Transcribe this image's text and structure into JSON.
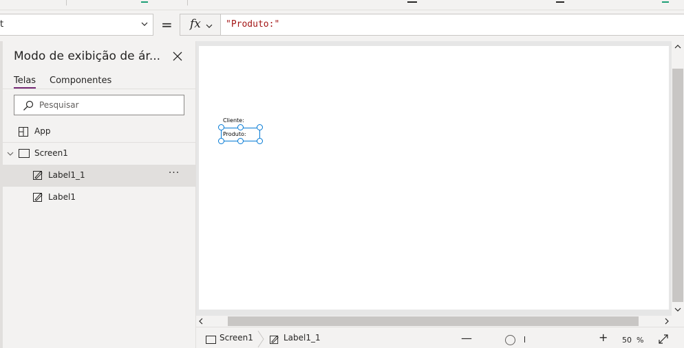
{
  "formula_bar": {
    "property_value": "t",
    "equals": "=",
    "fx_label": "fx",
    "formula": "\"Produto:\""
  },
  "tree_panel": {
    "title": "Modo de exibição de ár...",
    "tabs": [
      {
        "label": "Telas",
        "active": true
      },
      {
        "label": "Componentes",
        "active": false
      }
    ],
    "search_placeholder": "Pesquisar",
    "items": [
      {
        "label": "App",
        "icon": "app-grid-icon"
      },
      {
        "label": "Screen1",
        "icon": "screen-icon",
        "expanded": true
      },
      {
        "label": "Label1_1",
        "icon": "label-edit-icon",
        "selected": true,
        "more": "···"
      },
      {
        "label": "Label1",
        "icon": "label-edit-icon"
      }
    ]
  },
  "canvas": {
    "labels": [
      {
        "text": "Cliente:"
      },
      {
        "text": "Produto:",
        "selected": true
      }
    ]
  },
  "status_bar": {
    "breadcrumb": [
      {
        "label": "Screen1",
        "icon": "screen-icon"
      },
      {
        "label": "Label1_1",
        "icon": "label-edit-icon"
      }
    ],
    "zoom_minus": "—",
    "zoom_plus": "+",
    "zoom_value": "50",
    "zoom_unit": "%"
  },
  "colors": {
    "accent": "#742774",
    "selection": "#0078d4",
    "formula_string": "#a31515",
    "selected_row": "#e1dfdd"
  }
}
